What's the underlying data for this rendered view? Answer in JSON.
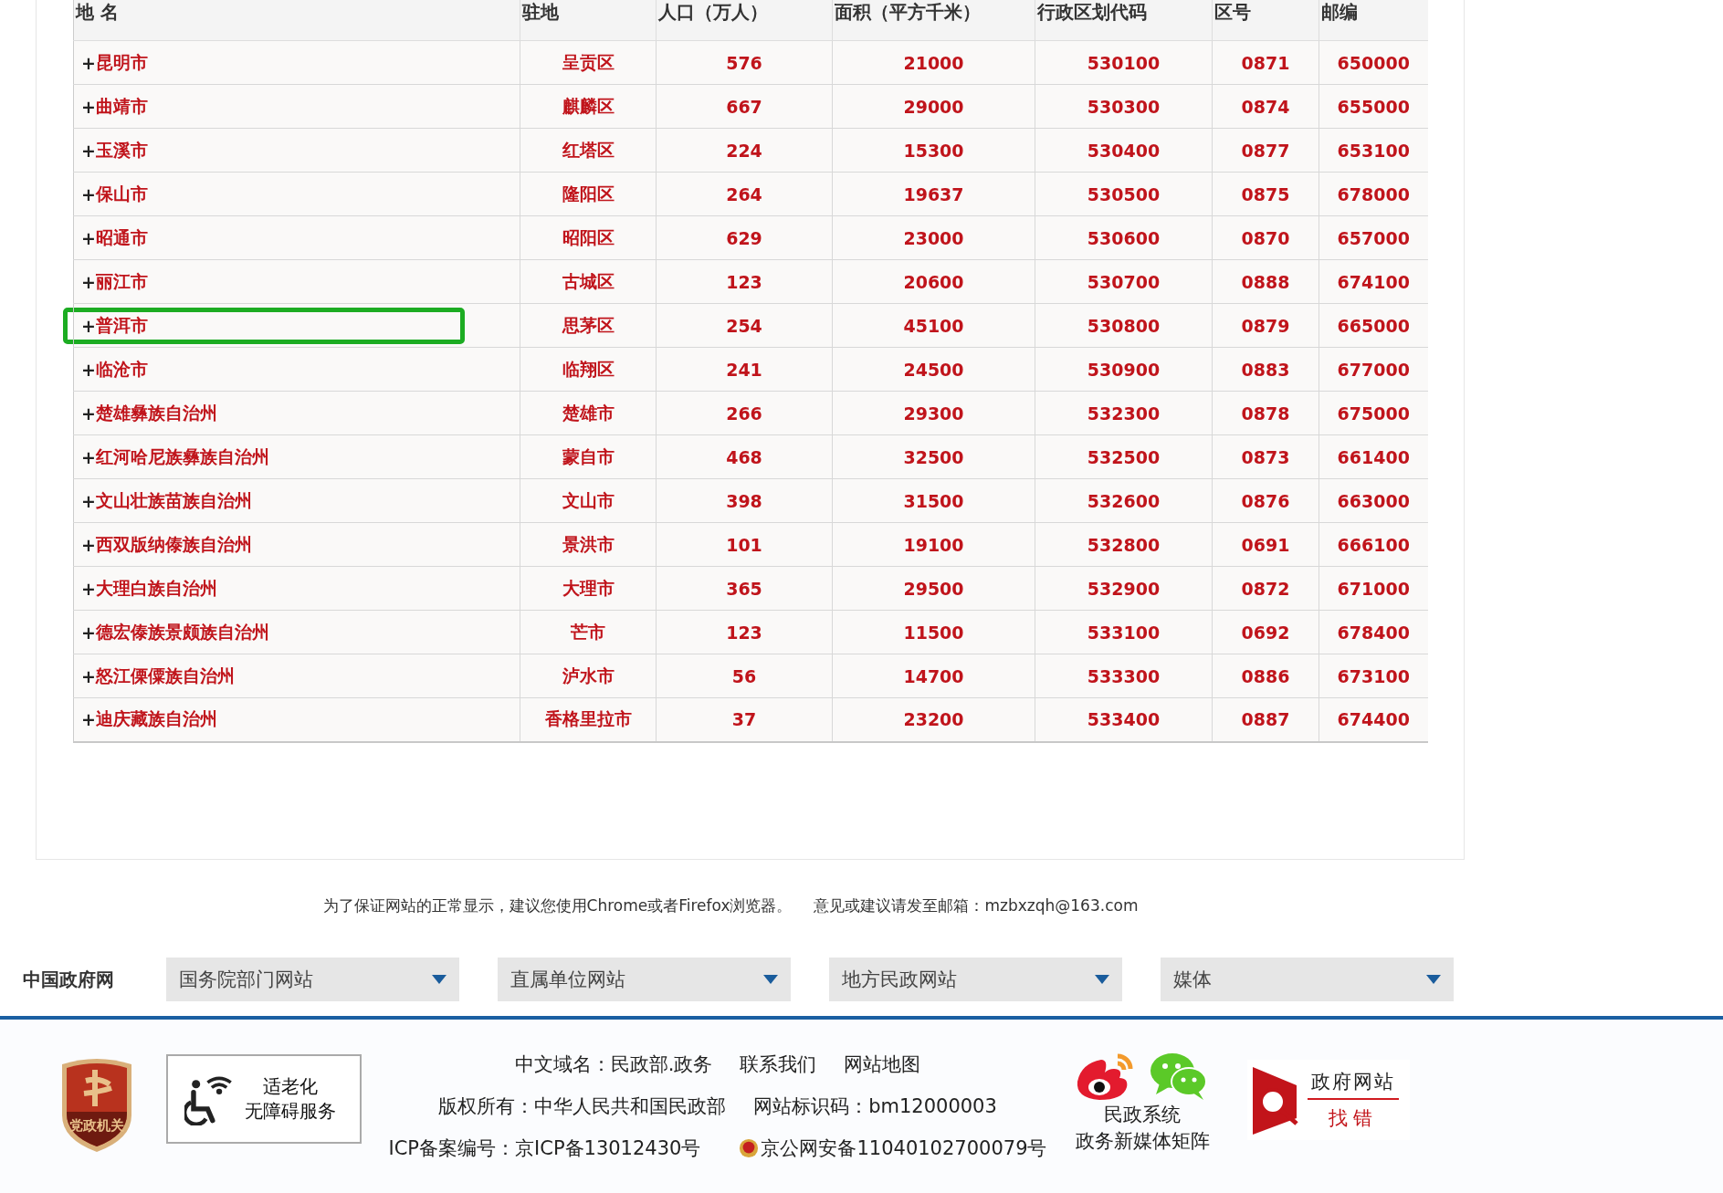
{
  "table": {
    "columns": [
      "地 名",
      "驻地",
      "人口（万人）",
      "面积（平方千米）",
      "行政区划代码",
      "区号",
      "邮编"
    ],
    "rows": [
      {
        "expander": "+",
        "cells": [
          "昆明市",
          "呈贡区",
          "576",
          "21000",
          "530100",
          "0871",
          "650000"
        ],
        "selected": false
      },
      {
        "expander": "+",
        "cells": [
          "曲靖市",
          "麒麟区",
          "667",
          "29000",
          "530300",
          "0874",
          "655000"
        ],
        "selected": false
      },
      {
        "expander": "+",
        "cells": [
          "玉溪市",
          "红塔区",
          "224",
          "15300",
          "530400",
          "0877",
          "653100"
        ],
        "selected": false
      },
      {
        "expander": "+",
        "cells": [
          "保山市",
          "隆阳区",
          "264",
          "19637",
          "530500",
          "0875",
          "678000"
        ],
        "selected": false
      },
      {
        "expander": "+",
        "cells": [
          "昭通市",
          "昭阳区",
          "629",
          "23000",
          "530600",
          "0870",
          "657000"
        ],
        "selected": false
      },
      {
        "expander": "+",
        "cells": [
          "丽江市",
          "古城区",
          "123",
          "20600",
          "530700",
          "0888",
          "674100"
        ],
        "selected": false
      },
      {
        "expander": "+",
        "cells": [
          "普洱市",
          "思茅区",
          "254",
          "45100",
          "530800",
          "0879",
          "665000"
        ],
        "selected": true
      },
      {
        "expander": "+",
        "cells": [
          "临沧市",
          "临翔区",
          "241",
          "24500",
          "530900",
          "0883",
          "677000"
        ],
        "selected": false
      },
      {
        "expander": "+",
        "cells": [
          "楚雄彝族自治州",
          "楚雄市",
          "266",
          "29300",
          "532300",
          "0878",
          "675000"
        ],
        "selected": false
      },
      {
        "expander": "+",
        "cells": [
          "红河哈尼族彝族自治州",
          "蒙自市",
          "468",
          "32500",
          "532500",
          "0873",
          "661400"
        ],
        "selected": false
      },
      {
        "expander": "+",
        "cells": [
          "文山壮族苗族自治州",
          "文山市",
          "398",
          "31500",
          "532600",
          "0876",
          "663000"
        ],
        "selected": false
      },
      {
        "expander": "+",
        "cells": [
          "西双版纳傣族自治州",
          "景洪市",
          "101",
          "19100",
          "532800",
          "0691",
          "666100"
        ],
        "selected": false
      },
      {
        "expander": "+",
        "cells": [
          "大理白族自治州",
          "大理市",
          "365",
          "29500",
          "532900",
          "0872",
          "671000"
        ],
        "selected": false
      },
      {
        "expander": "+",
        "cells": [
          "德宏傣族景颇族自治州",
          "芒市",
          "123",
          "11500",
          "533100",
          "0692",
          "678400"
        ],
        "selected": false
      },
      {
        "expander": "+",
        "cells": [
          "怒江傈僳族自治州",
          "泸水市",
          "56",
          "14700",
          "533300",
          "0886",
          "673100"
        ],
        "selected": false
      },
      {
        "expander": "+",
        "cells": [
          "迪庆藏族自治州",
          "香格里拉市",
          "37",
          "23200",
          "533400",
          "0887",
          "674400"
        ],
        "selected": false
      }
    ]
  },
  "notice": {
    "browser": "为了保证网站的正常显示，建议您使用Chrome或者Firefox浏览器。",
    "email": "意见或建议请发至邮箱：mzbxzqh@163.com"
  },
  "links_bar": {
    "label": "中国政府网",
    "dropdowns": [
      "国务院部门网站",
      "直属单位网站",
      "地方民政网站",
      "媒体"
    ]
  },
  "footer": {
    "badge": "党政机关",
    "accessibility": [
      "适老化",
      "无障碍服务"
    ],
    "line1": [
      "中文域名：民政部.政务",
      "联系我们",
      "网站地图"
    ],
    "line2": [
      "版权所有：中华人民共和国民政部",
      "网站标识码：bm12000003"
    ],
    "line3": [
      "ICP备案编号：京ICP备13012430号",
      "京公网安备11040102700079号"
    ],
    "media": [
      "民政系统",
      "政务新媒体矩阵"
    ],
    "error_report": {
      "top": "政府网站",
      "bottom": "找错"
    }
  }
}
